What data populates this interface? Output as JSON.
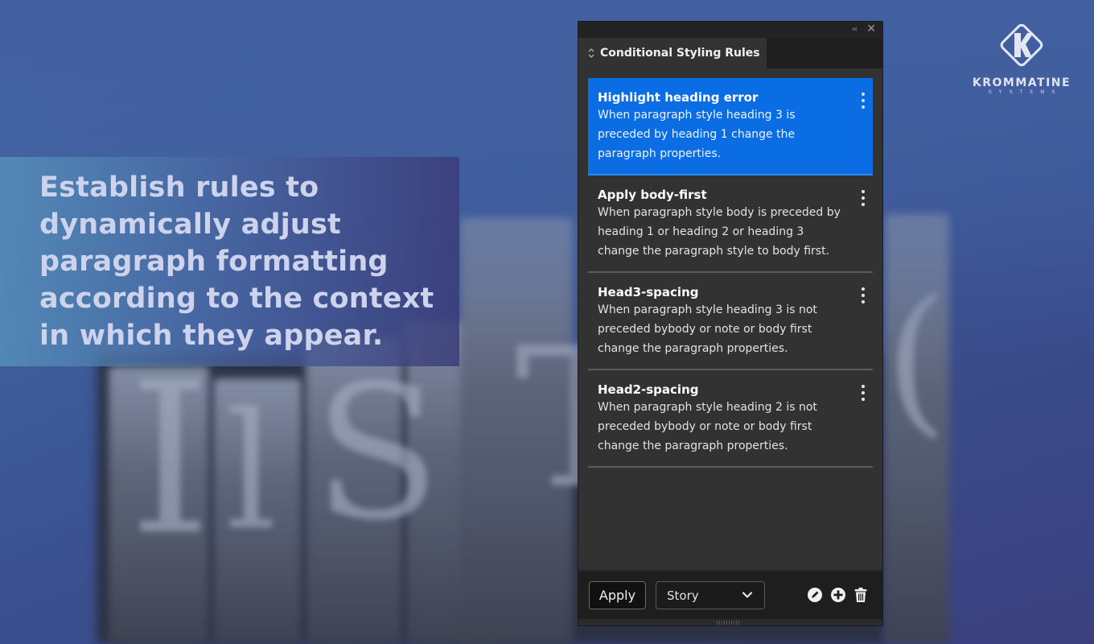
{
  "headline": "Establish rules to dynamically adjust paragraph formatting according to the context in which they appear.",
  "logo": {
    "name": "KROMMATINE",
    "subtitle": "SYSTEMS",
    "icon": "k-diamond-logo"
  },
  "panel": {
    "topbar": {
      "collapse_label": "‹‹",
      "close_label": "✕"
    },
    "tab": {
      "label": "Conditional Styling Rules",
      "icon": "updown-arrows-icon"
    },
    "rules": [
      {
        "title": "Highlight heading error",
        "description": "When paragraph style heading 3 is preceded by heading 1 change the paragraph properties.",
        "selected": true
      },
      {
        "title": "Apply body-first",
        "description": "When paragraph style body is preceded by heading 1 or heading 2 or heading 3 change the paragraph style to body first.",
        "selected": false
      },
      {
        "title": "Head3-spacing",
        "description": "When paragraph style heading 3 is not preceded bybody or note or body first change the paragraph properties.",
        "selected": false
      },
      {
        "title": "Head2-spacing",
        "description": "When paragraph style heading 2 is not preceded bybody or note or body first change the paragraph properties.",
        "selected": false
      }
    ],
    "footer": {
      "apply_label": "Apply",
      "scope_value": "Story",
      "icons": [
        "edit-icon",
        "add-icon",
        "delete-icon"
      ]
    }
  },
  "colors": {
    "selected_rule": "#0a6de3",
    "panel_bg": "#323232",
    "headline_text": "#cdd3ec"
  }
}
